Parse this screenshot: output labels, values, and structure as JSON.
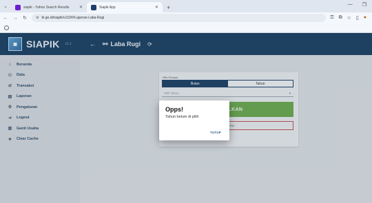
{
  "browser": {
    "tabs": [
      {
        "title": "siapik - Yahoo Search Results",
        "active": false
      },
      {
        "title": "Siapik App",
        "active": true
      }
    ],
    "url": "bi.go.id/siapik/v110/#/Laporan-Laba-Rugi"
  },
  "app": {
    "brand": "SIAPIK",
    "version": "v1.1",
    "page_title": "Laba Rugi"
  },
  "sidebar": {
    "items": [
      {
        "label": "Beranda",
        "icon": "home-icon"
      },
      {
        "label": "Data",
        "icon": "users-icon"
      },
      {
        "label": "Transaksi",
        "icon": "exchange-icon"
      },
      {
        "label": "Laporan",
        "icon": "report-icon"
      },
      {
        "label": "Pengaturan",
        "icon": "gear-icon"
      },
      {
        "label": "Logout",
        "icon": "logout-icon"
      },
      {
        "label": "Ganti Usaha",
        "icon": "building-icon"
      },
      {
        "label": "Clear Cache",
        "icon": "star-icon"
      }
    ]
  },
  "form": {
    "period_label": "Pilih Periode",
    "period_options": [
      "Bulan",
      "Tahun"
    ],
    "selected_period": "Bulan",
    "year_placeholder": "Pilih Tahun",
    "show_button": "TAMPILKAN",
    "back_button": "KEMBALI"
  },
  "dialog": {
    "title": "Opps!",
    "message": "Tahun belum di pilih",
    "close_button": "TUTUP"
  },
  "colors": {
    "primary": "#1b3f63",
    "success": "#6aa84f",
    "danger": "#b85450"
  }
}
